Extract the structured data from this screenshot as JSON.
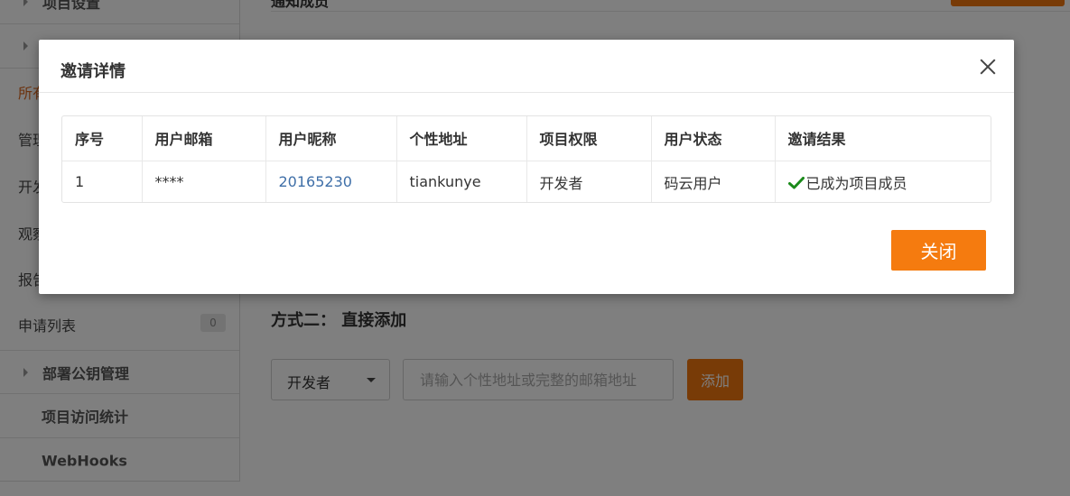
{
  "sidebar": {
    "group_project_settings": "项目设置",
    "item_all": "所有",
    "item_manage": "管理",
    "item_dev": "开发",
    "item_observe": "观察",
    "item_report": "报告",
    "item_applications": "申请列表",
    "applications_count": "0",
    "group_deploy_keys": "部署公钥管理",
    "item_visit_stats": "项目访问统计",
    "item_webhooks": "WebHooks"
  },
  "main": {
    "top_heading": "通知成员",
    "method_two_title": "方式二：  直接添加",
    "role_select_value": "开发者",
    "address_placeholder": "请输入个性地址或完整的邮箱地址",
    "add_button": "添加"
  },
  "modal": {
    "title": "邀请详情",
    "columns": [
      "序号",
      "用户邮箱",
      "用户昵称",
      "个性地址",
      "项目权限",
      "用户状态",
      "邀请结果"
    ],
    "rows": [
      {
        "index": "1",
        "email": "****",
        "nickname": "20165230",
        "personal_address": "tiankunye",
        "permission": "开发者",
        "status": "码云用户",
        "result": "已成为项目成员"
      }
    ],
    "close_button": "关闭"
  },
  "colors": {
    "accent": "#f57b0f",
    "success_check": "#1a8a1a",
    "link": "#3f6fa8"
  }
}
